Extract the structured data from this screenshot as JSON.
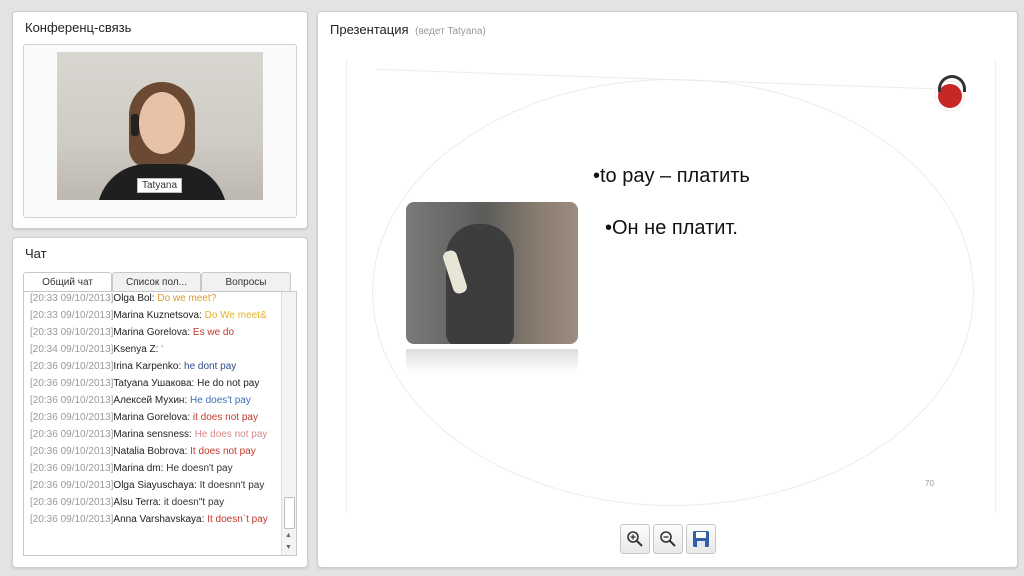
{
  "conference": {
    "title": "Конференц-связь",
    "video_name": "Tatyana"
  },
  "chat": {
    "title": "Чат",
    "tabs": [
      "Общий чат",
      "Список пол...",
      "Вопросы"
    ],
    "messages": [
      {
        "time": "[20:33 09/10/2013]",
        "author": "Olga Bol:",
        "text": "Do we meet?",
        "color": "#d99a2b"
      },
      {
        "time": "[20:33 09/10/2013]",
        "author": "Marina Kuznetsova:",
        "text": "Do We meet&",
        "color": "#e3b22f"
      },
      {
        "time": "[20:33 09/10/2013]",
        "author": "Marina Gorelova:",
        "text": "Es we do",
        "color": "#c0392b"
      },
      {
        "time": "[20:34 09/10/2013]",
        "author": "Ksenya Z:",
        "text": "'",
        "color": "#888888"
      },
      {
        "time": "[20:36 09/10/2013]",
        "author": "Irina Karpenko:",
        "text": "he dont pay",
        "color": "#2e4a8a"
      },
      {
        "time": "[20:36 09/10/2013]",
        "author": "Tatyana Ушакова:",
        "text": "He do not pay",
        "color": "#222222"
      },
      {
        "time": "[20:36 09/10/2013]",
        "author": "Алексей Мухин:",
        "text": "He does't pay",
        "color": "#3d6fb6"
      },
      {
        "time": "[20:36 09/10/2013]",
        "author": "Marina Gorelova:",
        "text": "it does not pay",
        "color": "#c0392b"
      },
      {
        "time": "[20:36 09/10/2013]",
        "author": "Marina sensness:",
        "text": "He does not pay",
        "color": "#d98a8a"
      },
      {
        "time": "[20:36 09/10/2013]",
        "author": "Natalia Bobrova:",
        "text": "It does not pay",
        "color": "#c0392b"
      },
      {
        "time": "[20:36 09/10/2013]",
        "author": "Marina dm:",
        "text": "He doesn't pay",
        "color": "#333333"
      },
      {
        "time": "[20:36 09/10/2013]",
        "author": "Olga Siayuschaya:",
        "text": "It doesnn't pay",
        "color": "#333333"
      },
      {
        "time": "[20:36 09/10/2013]",
        "author": "Alsu Terra:",
        "text": "it  doesn\"t pay",
        "color": "#333333"
      },
      {
        "time": "[20:36 09/10/2013]",
        "author": "Anna Varshavskaya:",
        "text": "It doesn`t pay",
        "color": "#c0392b"
      }
    ]
  },
  "presentation": {
    "title": "Презентация",
    "subtitle": "(ведет Tatyana)",
    "slide": {
      "bullet1": "•to pay – платить",
      "bullet2": "•Он не платит.",
      "number": "70"
    },
    "toolbar": {
      "icons": [
        "zoom-in-icon",
        "zoom-out-icon",
        "save-icon"
      ]
    }
  }
}
